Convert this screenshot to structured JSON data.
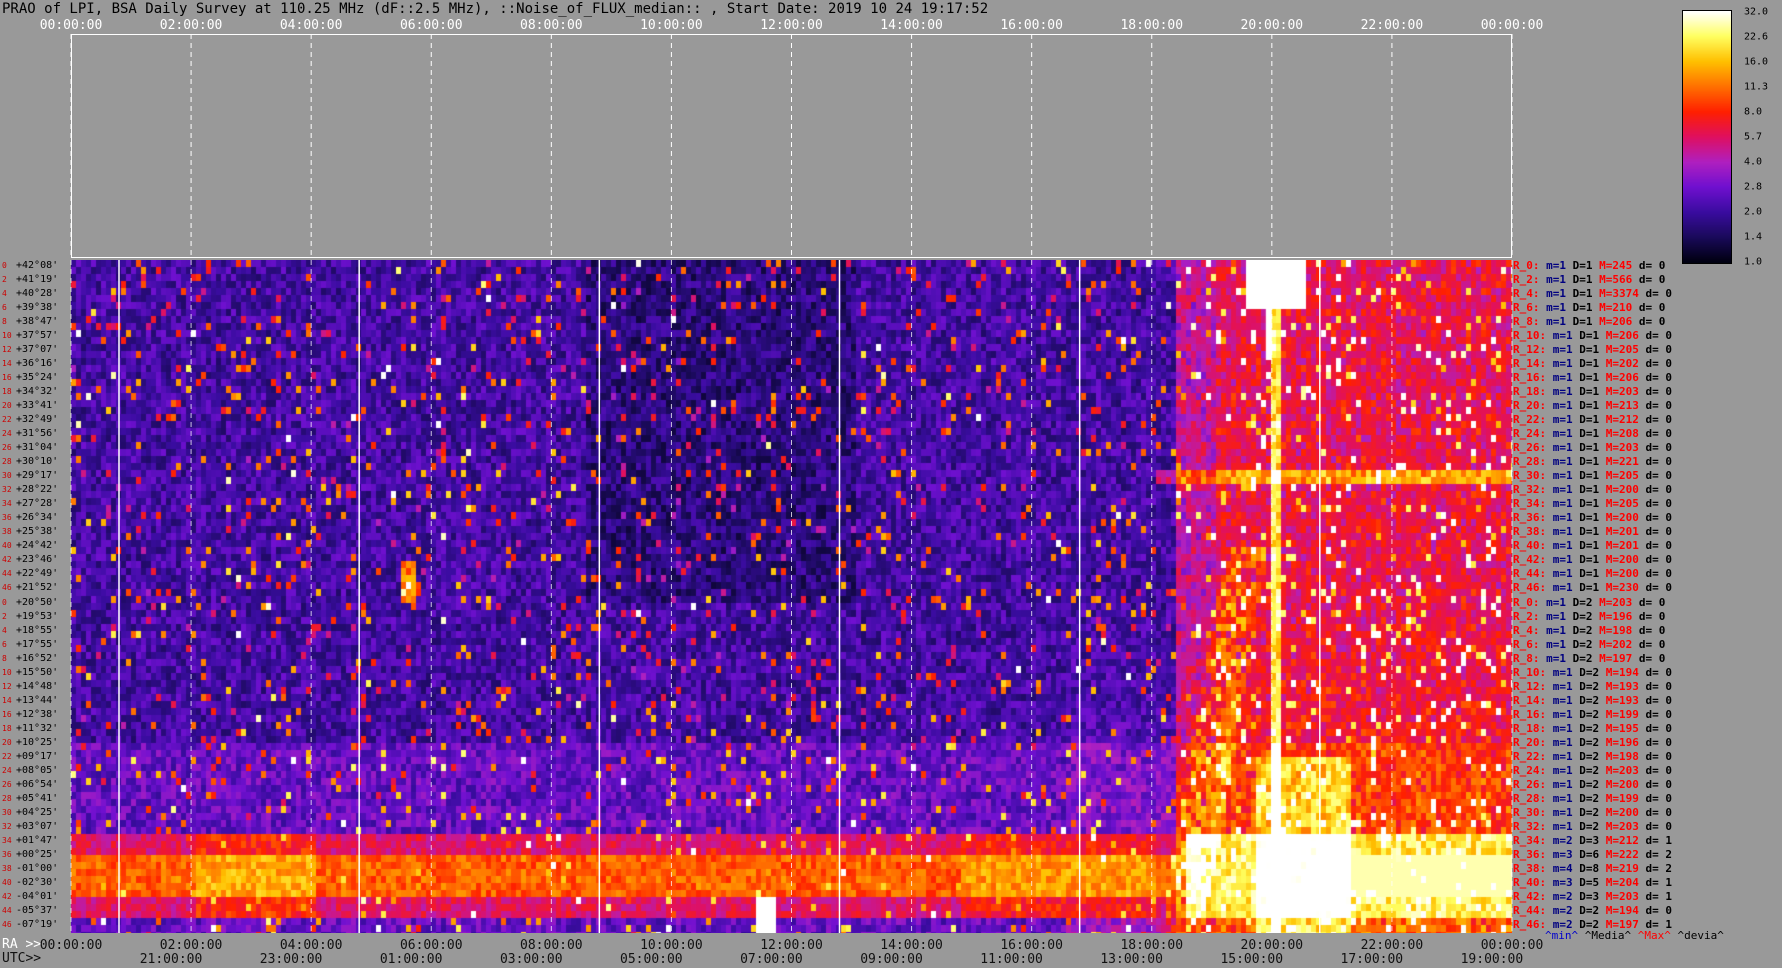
{
  "title": "PRAO of LPI, BSA Daily Survey at 110.25 MHz (dF::2.5 MHz), ::Noise_of_FLUX_median:: , Start Date: 2019 10 24 19:17:52",
  "top_axis_ticks": [
    "00:00:00",
    "02:00:00",
    "04:00:00",
    "06:00:00",
    "08:00:00",
    "10:00:00",
    "12:00:00",
    "14:00:00",
    "16:00:00",
    "18:00:00",
    "20:00:00",
    "22:00:00",
    "00:00:00"
  ],
  "bottom_axis": {
    "ra_label": "RA >>",
    "ra_ticks": [
      "00:00:00",
      "02:00:00",
      "04:00:00",
      "06:00:00",
      "08:00:00",
      "10:00:00",
      "12:00:00",
      "14:00:00",
      "16:00:00",
      "18:00:00",
      "20:00:00",
      "22:00:00",
      "00:00:00"
    ],
    "utc_label": "UTC>>",
    "utc_ticks": [
      "21:00:00",
      "23:00:00",
      "01:00:00",
      "03:00:00",
      "05:00:00",
      "07:00:00",
      "09:00:00",
      "11:00:00",
      "13:00:00",
      "15:00:00",
      "17:00:00",
      "19:00:00"
    ]
  },
  "row_labels": [
    "+42°08'",
    "+41°19'",
    "+40°28'",
    "+39°38'",
    "+38°47'",
    "+37°57'",
    "+37°07'",
    "+36°16'",
    "+35°24'",
    "+34°32'",
    "+33°41'",
    "+32°49'",
    "+31°56'",
    "+31°04'",
    "+30°10'",
    "+29°17'",
    "+28°22'",
    "+27°28'",
    "+26°34'",
    "+25°38'",
    "+24°42'",
    "+23°46'",
    "+22°49'",
    "+21°52'",
    "+20°50'",
    "+19°53'",
    "+18°55'",
    "+17°55'",
    "+16°52'",
    "+15°50'",
    "+14°48'",
    "+13°44'",
    "+12°38'",
    "+11°32'",
    "+10°25'",
    "+09°17'",
    "+08°05'",
    "+06°54'",
    "+05°41'",
    "+04°25'",
    "+03°07'",
    "+01°47'",
    "+00°25'",
    "-01°00'",
    "-02°30'",
    "-04°01'",
    "-05°37'",
    "-07°19'"
  ],
  "row_index_labels": [
    "0",
    "2",
    "4",
    "6",
    "8",
    "10",
    "12",
    "14",
    "16",
    "18",
    "20",
    "22",
    "24",
    "26",
    "28",
    "30",
    "32",
    "34",
    "36",
    "38",
    "40",
    "42",
    "44",
    "46",
    "0",
    "2",
    "4",
    "6",
    "8",
    "10",
    "12",
    "14",
    "16",
    "18",
    "20",
    "22",
    "24",
    "26",
    "28",
    "30",
    "32",
    "34",
    "36",
    "38",
    "40",
    "42",
    "44",
    "46"
  ],
  "right_rows": [
    {
      "r": "R_0:",
      "m": "m=1",
      "d": "D=1",
      "M": "M=245",
      "dv": "d= 0"
    },
    {
      "r": "R_2:",
      "m": "m=1",
      "d": "D=1",
      "M": "M=566",
      "dv": "d= 0"
    },
    {
      "r": "R_4:",
      "m": "m=1",
      "d": "D=1",
      "M": "M=3374",
      "dv": "d= 0"
    },
    {
      "r": "R_6:",
      "m": "m=1",
      "d": "D=1",
      "M": "M=210",
      "dv": "d= 0"
    },
    {
      "r": "R_8:",
      "m": "m=1",
      "d": "D=1",
      "M": "M=206",
      "dv": "d= 0"
    },
    {
      "r": "R_10:",
      "m": "m=1",
      "d": "D=1",
      "M": "M=206",
      "dv": "d= 0"
    },
    {
      "r": "R_12:",
      "m": "m=1",
      "d": "D=1",
      "M": "M=205",
      "dv": "d= 0"
    },
    {
      "r": "R_14:",
      "m": "m=1",
      "d": "D=1",
      "M": "M=202",
      "dv": "d= 0"
    },
    {
      "r": "R_16:",
      "m": "m=1",
      "d": "D=1",
      "M": "M=206",
      "dv": "d= 0"
    },
    {
      "r": "R_18:",
      "m": "m=1",
      "d": "D=1",
      "M": "M=203",
      "dv": "d= 0"
    },
    {
      "r": "R_20:",
      "m": "m=1",
      "d": "D=1",
      "M": "M=213",
      "dv": "d= 0"
    },
    {
      "r": "R_22:",
      "m": "m=1",
      "d": "D=1",
      "M": "M=212",
      "dv": "d= 0"
    },
    {
      "r": "R_24:",
      "m": "m=1",
      "d": "D=1",
      "M": "M=208",
      "dv": "d= 0"
    },
    {
      "r": "R_26:",
      "m": "m=1",
      "d": "D=1",
      "M": "M=203",
      "dv": "d= 0"
    },
    {
      "r": "R_28:",
      "m": "m=1",
      "d": "D=1",
      "M": "M=221",
      "dv": "d= 0"
    },
    {
      "r": "R_30:",
      "m": "m=1",
      "d": "D=1",
      "M": "M=205",
      "dv": "d= 0"
    },
    {
      "r": "R_32:",
      "m": "m=1",
      "d": "D=1",
      "M": "M=200",
      "dv": "d= 0"
    },
    {
      "r": "R_34:",
      "m": "m=1",
      "d": "D=1",
      "M": "M=205",
      "dv": "d= 0"
    },
    {
      "r": "R_36:",
      "m": "m=1",
      "d": "D=1",
      "M": "M=200",
      "dv": "d= 0"
    },
    {
      "r": "R_38:",
      "m": "m=1",
      "d": "D=1",
      "M": "M=201",
      "dv": "d= 0"
    },
    {
      "r": "R_40:",
      "m": "m=1",
      "d": "D=1",
      "M": "M=201",
      "dv": "d= 0"
    },
    {
      "r": "R_42:",
      "m": "m=1",
      "d": "D=1",
      "M": "M=200",
      "dv": "d= 0"
    },
    {
      "r": "R_44:",
      "m": "m=1",
      "d": "D=1",
      "M": "M=200",
      "dv": "d= 0"
    },
    {
      "r": "R_46:",
      "m": "m=1",
      "d": "D=1",
      "M": "M=230",
      "dv": "d= 0"
    },
    {
      "r": "R_0:",
      "m": "m=1",
      "d": "D=2",
      "M": "M=203",
      "dv": "d= 0"
    },
    {
      "r": "R_2:",
      "m": "m=1",
      "d": "D=2",
      "M": "M=196",
      "dv": "d= 0"
    },
    {
      "r": "R_4:",
      "m": "m=1",
      "d": "D=2",
      "M": "M=198",
      "dv": "d= 0"
    },
    {
      "r": "R_6:",
      "m": "m=1",
      "d": "D=2",
      "M": "M=202",
      "dv": "d= 0"
    },
    {
      "r": "R_8:",
      "m": "m=1",
      "d": "D=2",
      "M": "M=197",
      "dv": "d= 0"
    },
    {
      "r": "R_10:",
      "m": "m=1",
      "d": "D=2",
      "M": "M=194",
      "dv": "d= 0"
    },
    {
      "r": "R_12:",
      "m": "m=1",
      "d": "D=2",
      "M": "M=193",
      "dv": "d= 0"
    },
    {
      "r": "R_14:",
      "m": "m=1",
      "d": "D=2",
      "M": "M=193",
      "dv": "d= 0"
    },
    {
      "r": "R_16:",
      "m": "m=1",
      "d": "D=2",
      "M": "M=199",
      "dv": "d= 0"
    },
    {
      "r": "R_18:",
      "m": "m=1",
      "d": "D=2",
      "M": "M=195",
      "dv": "d= 0"
    },
    {
      "r": "R_20:",
      "m": "m=1",
      "d": "D=2",
      "M": "M=196",
      "dv": "d= 0"
    },
    {
      "r": "R_22:",
      "m": "m=1",
      "d": "D=2",
      "M": "M=198",
      "dv": "d= 0"
    },
    {
      "r": "R_24:",
      "m": "m=1",
      "d": "D=2",
      "M": "M=203",
      "dv": "d= 0"
    },
    {
      "r": "R_26:",
      "m": "m=1",
      "d": "D=2",
      "M": "M=200",
      "dv": "d= 0"
    },
    {
      "r": "R_28:",
      "m": "m=1",
      "d": "D=2",
      "M": "M=199",
      "dv": "d= 0"
    },
    {
      "r": "R_30:",
      "m": "m=1",
      "d": "D=2",
      "M": "M=200",
      "dv": "d= 0"
    },
    {
      "r": "R_32:",
      "m": "m=1",
      "d": "D=2",
      "M": "M=203",
      "dv": "d= 0"
    },
    {
      "r": "R_34:",
      "m": "m=2",
      "d": "D=3",
      "M": "M=212",
      "dv": "d= 1"
    },
    {
      "r": "R_36:",
      "m": "m=3",
      "d": "D=6",
      "M": "M=222",
      "dv": "d= 2"
    },
    {
      "r": "R_38:",
      "m": "m=4",
      "d": "D=8",
      "M": "M=219",
      "dv": "d= 2"
    },
    {
      "r": "R_40:",
      "m": "m=3",
      "d": "D=5",
      "M": "M=204",
      "dv": "d= 1"
    },
    {
      "r": "R_42:",
      "m": "m=2",
      "d": "D=3",
      "M": "M=203",
      "dv": "d= 1"
    },
    {
      "r": "R_44:",
      "m": "m=2",
      "d": "D=2",
      "M": "M=194",
      "dv": "d= 0"
    },
    {
      "r": "R_46:",
      "m": "m=2",
      "d": "D=2",
      "M": "M=197",
      "dv": "d= 1"
    }
  ],
  "legend_footer": {
    "min": "^min^",
    "median": "^Media^",
    "max": "^Max^",
    "dev": "^devia^"
  },
  "colorbar": {
    "ticks": [
      "32.0",
      "22.6",
      "16.0",
      "11.3",
      "8.0",
      "5.7",
      "4.0",
      "2.8",
      "2.0",
      "1.4",
      "1.0"
    ],
    "scale": "log",
    "colors": [
      "#000010",
      "#1a0a5a",
      "#3a0ca0",
      "#7010d0",
      "#b020c0",
      "#e01060",
      "#ff2000",
      "#ff7000",
      "#ffc000",
      "#ffff60",
      "#ffffff"
    ]
  },
  "chart_data": {
    "type": "heatmap",
    "title": "PRAO of LPI, BSA Daily Survey at 110.25 MHz (dF::2.5 MHz), ::Noise_of_FLUX_median:: , Start Date: 2019 10 24 19:17:52",
    "x_axis_top": "RA",
    "x_axis_bottom": "UTC",
    "y_labels": "declination rows +42°08' .. -07°19' (48 beams)",
    "value_range": [
      1.0,
      32.0
    ],
    "scale": "log",
    "features": [
      {
        "kind": "band",
        "rows": [
          41,
          46
        ],
        "ra_from": "00:00:00",
        "ra_to": "24:00:00",
        "level": "8-32"
      },
      {
        "kind": "source",
        "ra": "20:00:00",
        "rows": [
          0,
          3
        ],
        "level": "32"
      },
      {
        "kind": "source",
        "ra": "11:50:00",
        "rows": [
          46,
          47
        ],
        "level": "32"
      },
      {
        "kind": "diffuse",
        "ra_from": "18:30:00",
        "ra_to": "24:00:00",
        "rows": [
          20,
          47
        ],
        "level": "4-16"
      }
    ]
  }
}
